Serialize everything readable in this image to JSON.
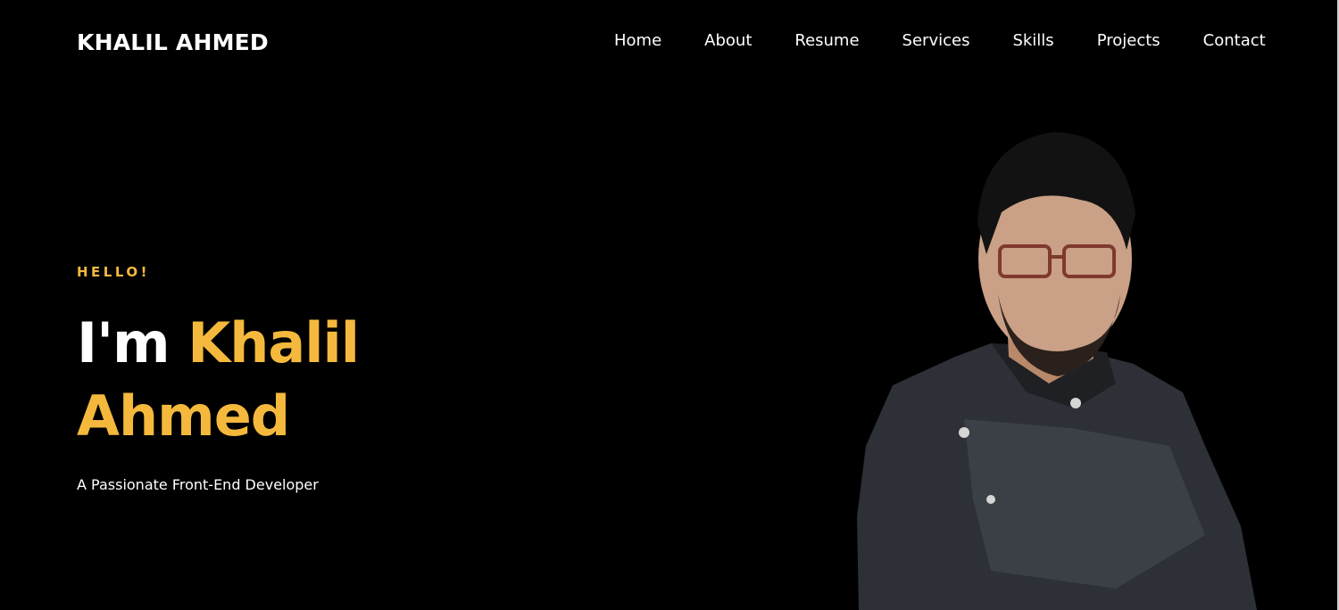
{
  "header": {
    "brand": "KHALIL AHMED",
    "nav": [
      "Home",
      "About",
      "Resume",
      "Services",
      "Skills",
      "Projects",
      "Contact"
    ]
  },
  "hero": {
    "greeting": "HELLO!",
    "headline_prefix": "I'm",
    "headline_first": "Khalil",
    "headline_last": "Ahmed",
    "tagline": "A Passionate Front-End Developer"
  },
  "colors": {
    "background": "#000000",
    "accent": "#f4b93c",
    "text": "#ffffff"
  }
}
